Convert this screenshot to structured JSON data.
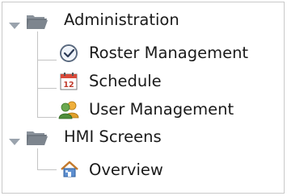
{
  "tree": {
    "admin_folder": {
      "label": "Administration",
      "icon": "folder-open-icon",
      "children": [
        {
          "label": "Roster Management",
          "icon": "clock-icon"
        },
        {
          "label": "Schedule",
          "icon": "calendar-icon",
          "calendar_day": "12"
        },
        {
          "label": "User Management",
          "icon": "users-icon"
        }
      ]
    },
    "hmi_folder": {
      "label": "HMI Screens",
      "icon": "folder-open-icon",
      "children": [
        {
          "label": "Overview",
          "icon": "home-icon"
        }
      ]
    }
  },
  "colors": {
    "folder": "#6f7780",
    "expander": "#9aa3ad",
    "guide_line": "#c4c4c4",
    "border": "#c9c9c9"
  }
}
